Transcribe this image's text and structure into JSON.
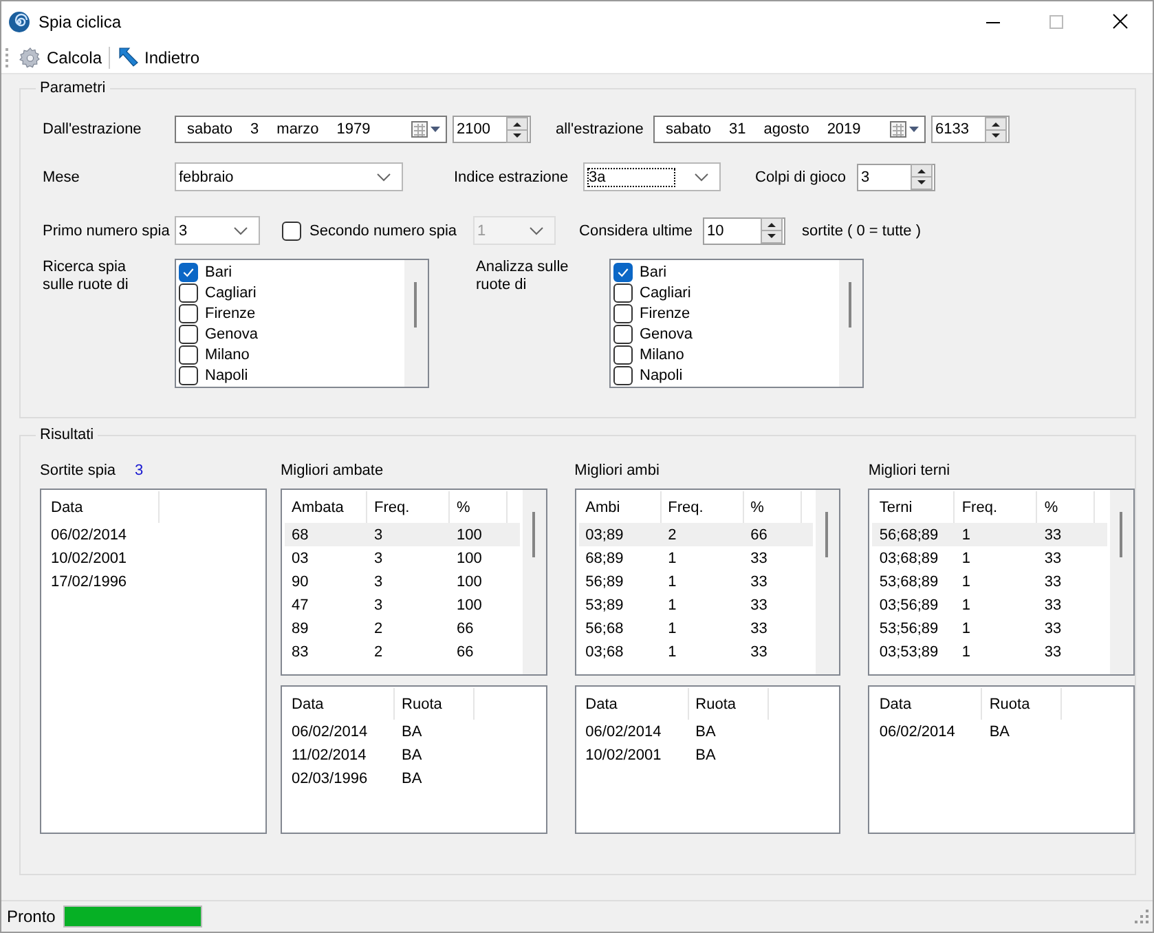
{
  "window": {
    "title": "Spia ciclica"
  },
  "toolbar": [
    {
      "kind": "gear",
      "label": "Calcola"
    },
    {
      "kind": "back",
      "label": "Indietro"
    }
  ],
  "parametri": {
    "title": "Parametri",
    "from": {
      "label": "Dall'estrazione",
      "date": [
        "sabato",
        "3",
        "marzo",
        "1979"
      ],
      "number": "2100"
    },
    "to": {
      "label": "all'estrazione",
      "date": [
        "sabato",
        "31",
        "agosto",
        "2019"
      ],
      "number": "6133"
    },
    "mese": {
      "label": "Mese",
      "value": "febbraio"
    },
    "indice": {
      "label": "Indice estrazione",
      "value": "3a",
      "focused": true
    },
    "colpi": {
      "label": "Colpi di gioco",
      "value": "3"
    },
    "primo": {
      "label": "Primo numero spia",
      "value": "3"
    },
    "secondo": {
      "label": "Secondo numero spia",
      "checked": false,
      "value": "1",
      "disabled": true
    },
    "considera": {
      "label": "Considera ultime",
      "value": "10",
      "suffix": "sortite ( 0 = tutte )"
    },
    "ricerca": {
      "label": "Ricerca spia sulle ruote di",
      "items": [
        {
          "label": "Bari",
          "checked": true
        },
        {
          "label": "Cagliari",
          "checked": false
        },
        {
          "label": "Firenze",
          "checked": false
        },
        {
          "label": "Genova",
          "checked": false
        },
        {
          "label": "Milano",
          "checked": false
        },
        {
          "label": "Napoli",
          "checked": false
        }
      ]
    },
    "analizza": {
      "label": "Analizza sulle ruote di",
      "items": [
        {
          "label": "Bari",
          "checked": true
        },
        {
          "label": "Cagliari",
          "checked": false
        },
        {
          "label": "Firenze",
          "checked": false
        },
        {
          "label": "Genova",
          "checked": false
        },
        {
          "label": "Milano",
          "checked": false
        },
        {
          "label": "Napoli",
          "checked": false
        }
      ]
    }
  },
  "risultati": {
    "title": "Risultati",
    "sortite": {
      "label": "Sortite spia",
      "count": "3",
      "columns": [
        "Data"
      ],
      "rows": [
        {
          "cells": [
            "06/02/2014"
          ],
          "selected": false
        },
        {
          "cells": [
            "10/02/2001"
          ],
          "selected": false
        },
        {
          "cells": [
            "17/02/1996"
          ],
          "selected": false
        }
      ]
    },
    "panels": [
      {
        "title": "Migliori ambate",
        "table": {
          "columns": [
            "Ambata",
            "Freq.",
            "%"
          ],
          "rows": [
            {
              "cells": [
                "68",
                "3",
                "100"
              ],
              "selected": true
            },
            {
              "cells": [
                "03",
                "3",
                "100"
              ],
              "selected": false
            },
            {
              "cells": [
                "90",
                "3",
                "100"
              ],
              "selected": false
            },
            {
              "cells": [
                "47",
                "3",
                "100"
              ],
              "selected": false
            },
            {
              "cells": [
                "89",
                "2",
                "66"
              ],
              "selected": false
            },
            {
              "cells": [
                "83",
                "2",
                "66"
              ],
              "selected": false
            }
          ]
        },
        "detail": {
          "columns": [
            "Data",
            "Ruota"
          ],
          "rows": [
            {
              "cells": [
                "06/02/2014",
                "BA"
              ],
              "selected": false
            },
            {
              "cells": [
                "11/02/2014",
                "BA"
              ],
              "selected": false
            },
            {
              "cells": [
                "02/03/1996",
                "BA"
              ],
              "selected": false
            }
          ]
        }
      },
      {
        "title": "Migliori ambi",
        "table": {
          "columns": [
            "Ambi",
            "Freq.",
            "%"
          ],
          "rows": [
            {
              "cells": [
                "03;89",
                "2",
                "66"
              ],
              "selected": true
            },
            {
              "cells": [
                "68;89",
                "1",
                "33"
              ],
              "selected": false
            },
            {
              "cells": [
                "56;89",
                "1",
                "33"
              ],
              "selected": false
            },
            {
              "cells": [
                "53;89",
                "1",
                "33"
              ],
              "selected": false
            },
            {
              "cells": [
                "56;68",
                "1",
                "33"
              ],
              "selected": false
            },
            {
              "cells": [
                "03;68",
                "1",
                "33"
              ],
              "selected": false
            }
          ]
        },
        "detail": {
          "columns": [
            "Data",
            "Ruota"
          ],
          "rows": [
            {
              "cells": [
                "06/02/2014",
                "BA"
              ],
              "selected": false
            },
            {
              "cells": [
                "10/02/2001",
                "BA"
              ],
              "selected": false
            }
          ]
        }
      },
      {
        "title": "Migliori terni",
        "table": {
          "columns": [
            "Terni",
            "Freq.",
            "%"
          ],
          "rows": [
            {
              "cells": [
                "56;68;89",
                "1",
                "33"
              ],
              "selected": true
            },
            {
              "cells": [
                "03;68;89",
                "1",
                "33"
              ],
              "selected": false
            },
            {
              "cells": [
                "53;68;89",
                "1",
                "33"
              ],
              "selected": false
            },
            {
              "cells": [
                "03;56;89",
                "1",
                "33"
              ],
              "selected": false
            },
            {
              "cells": [
                "53;56;89",
                "1",
                "33"
              ],
              "selected": false
            },
            {
              "cells": [
                "03;53;89",
                "1",
                "33"
              ],
              "selected": false
            }
          ]
        },
        "detail": {
          "columns": [
            "Data",
            "Ruota"
          ],
          "rows": [
            {
              "cells": [
                "06/02/2014",
                "BA"
              ],
              "selected": false
            }
          ]
        }
      }
    ]
  },
  "status_bar": {
    "text": "Pronto",
    "level": 1
  }
}
